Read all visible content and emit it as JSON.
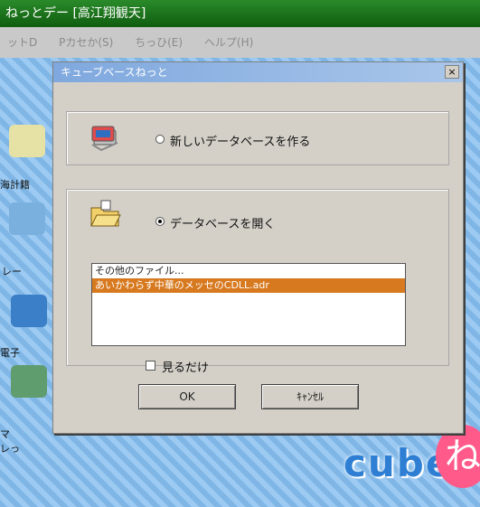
{
  "app": {
    "title": "ねっとデー [高江翔観天]",
    "menu": [
      "ットD",
      "Pカセか(S)",
      "ちっひ(E)",
      "ヘルプ(H)"
    ]
  },
  "desktop": {
    "labels": [
      "海計籍",
      "レー",
      "電子",
      "マ\nレっ"
    ]
  },
  "brand": {
    "word": "cube",
    "mark": "ね"
  },
  "dialog": {
    "title": "キューブベースねっと",
    "close_glyph": "×",
    "new_db_label": "新しいデータベースを作る",
    "open_db_label": "データベースを開く",
    "list_items": [
      "その他のファイル...",
      "あいかわらず中華のメッセのCDLL.adr"
    ],
    "selected_index": 1,
    "readonly_label": "見るだけ",
    "ok_label": "OK",
    "cancel_label": "ｷｬﾝｾﾙ"
  }
}
